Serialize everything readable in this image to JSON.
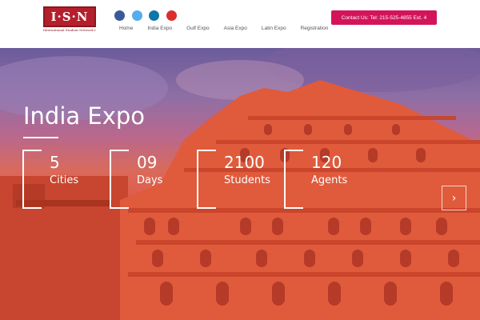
{
  "logo": {
    "text": "I·S·N",
    "subtitle": "International Student Network Inc."
  },
  "social": [
    {
      "icon": "facebook-icon",
      "color": "#3b5998"
    },
    {
      "icon": "twitter-icon",
      "color": "#55acee"
    },
    {
      "icon": "linkedin-icon",
      "color": "#0e76a8"
    },
    {
      "icon": "google-plus-icon",
      "color": "#dd2c2c"
    }
  ],
  "nav": [
    "Home",
    "India Expo",
    "Gulf Expo",
    "Asia Expo",
    "Latin Expo",
    "Registration"
  ],
  "contact_button": "Contact Us: Tel: 215-525-4855 Ext. 4",
  "hero": {
    "title": "India Expo",
    "stats": [
      {
        "number": "5",
        "label": "Cities"
      },
      {
        "number": "09",
        "label": "Days"
      },
      {
        "number": "2100",
        "label": "Students"
      },
      {
        "number": "120",
        "label": "Agents"
      }
    ],
    "next_arrow": "›"
  },
  "colors": {
    "accent": "#d4145a",
    "logo": "#b41f2c"
  }
}
